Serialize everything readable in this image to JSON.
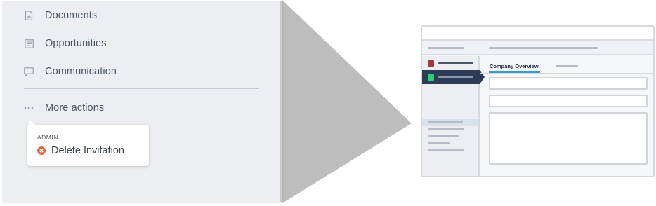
{
  "left_panel": {
    "nav_items": [
      {
        "label": "Documents",
        "icon": "document-icon"
      },
      {
        "label": "Opportunities",
        "icon": "list-icon"
      },
      {
        "label": "Communication",
        "icon": "chat-icon"
      }
    ],
    "more_actions": {
      "label": "More actions",
      "icon": "ellipsis-icon"
    },
    "popup": {
      "section_label": "ADMIN",
      "item": {
        "label": "Delete Invitation",
        "icon": "remove-circle-icon"
      }
    }
  },
  "thumbnail": {
    "active_tab_label": "Company Overview"
  },
  "colors": {
    "panel_bg": "#eceef2",
    "callout_gray": "#bdbdbd",
    "accent_blue": "#3b9ac9",
    "nav_active": "#2e3b55",
    "delete_icon": "#e06a3c",
    "marker_red": "#a33a3a",
    "marker_green": "#27d07a"
  }
}
